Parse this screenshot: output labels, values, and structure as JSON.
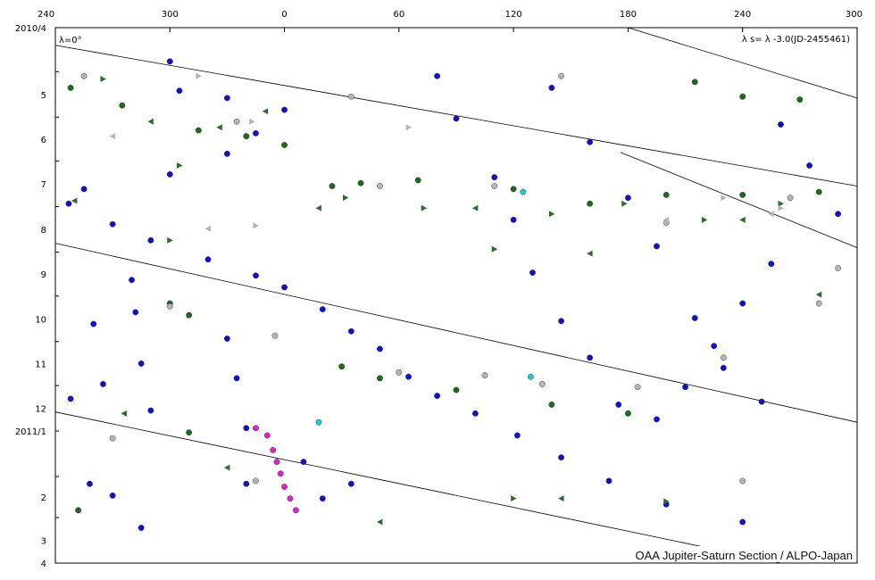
{
  "chart_data": {
    "type": "scatter",
    "title": "",
    "xlabel": "",
    "ylabel": "",
    "x_ticks": [
      "240",
      "300",
      "0",
      "60",
      "120",
      "180",
      "240",
      "300"
    ],
    "x_tick_longitudes": [
      240,
      300,
      360,
      420,
      480,
      540,
      600,
      660
    ],
    "xlim": [
      240,
      660
    ],
    "y_ticks": [
      "2010/4",
      "5",
      "6",
      "7",
      "8",
      "9",
      "10",
      "11",
      "12",
      "2011/1",
      "2",
      "3",
      "4"
    ],
    "ylim": [
      "2010-04-01",
      "2011-04-01"
    ],
    "grid": false,
    "annotations": {
      "lambda_label": "λ=0°",
      "system_label": "λ s= λ -3.0(JD-2455461)",
      "credit": "OAA Jupiter-Saturn Section / ALPO-Japan"
    },
    "reference_lines": [
      {
        "from": [
          240,
          "2010-04-13"
        ],
        "to": [
          660,
          "2010-07-18"
        ]
      },
      {
        "from": [
          240,
          "2010-08-26"
        ],
        "to": [
          660,
          "2010-12-26"
        ]
      },
      {
        "from": [
          240,
          "2010-12-19"
        ],
        "to": [
          620,
          "2011-04-01"
        ]
      },
      {
        "from": [
          540,
          "2010-04-01"
        ],
        "to": [
          660,
          "2010-05-19"
        ]
      },
      {
        "from": [
          536,
          "2010-06-25"
        ],
        "to": [
          660,
          "2010-08-29"
        ]
      }
    ],
    "series": [
      {
        "marker": "circle",
        "color": "#1111cc",
        "points": [
          [
            300,
            "2010-04-24"
          ],
          [
            305,
            "2010-05-14"
          ],
          [
            330,
            "2010-05-19"
          ],
          [
            360,
            "2010-05-27"
          ],
          [
            345,
            "2010-06-12"
          ],
          [
            330,
            "2010-06-26"
          ],
          [
            300,
            "2010-07-10"
          ],
          [
            255,
            "2010-07-20"
          ],
          [
            247,
            "2010-07-30"
          ],
          [
            270,
            "2010-08-13"
          ],
          [
            290,
            "2010-08-24"
          ],
          [
            320,
            "2010-09-06"
          ],
          [
            345,
            "2010-09-17"
          ],
          [
            360,
            "2010-09-25"
          ],
          [
            380,
            "2010-10-10"
          ],
          [
            395,
            "2010-10-25"
          ],
          [
            410,
            "2010-11-06"
          ],
          [
            425,
            "2010-11-25"
          ],
          [
            440,
            "2010-12-08"
          ],
          [
            460,
            "2010-12-20"
          ],
          [
            482,
            "2011-01-04"
          ],
          [
            505,
            "2011-01-19"
          ],
          [
            530,
            "2011-02-04"
          ],
          [
            560,
            "2011-02-20"
          ],
          [
            600,
            "2011-03-04"
          ],
          [
            620,
            "2010-06-06"
          ],
          [
            635,
            "2010-07-04"
          ],
          [
            650,
            "2010-08-06"
          ],
          [
            615,
            "2010-09-09"
          ],
          [
            600,
            "2010-10-06"
          ],
          [
            585,
            "2010-11-04"
          ],
          [
            570,
            "2010-12-02"
          ],
          [
            555,
            "2010-12-24"
          ],
          [
            500,
            "2010-05-12"
          ],
          [
            520,
            "2010-06-18"
          ],
          [
            540,
            "2010-07-26"
          ],
          [
            555,
            "2010-08-28"
          ],
          [
            575,
            "2010-10-16"
          ],
          [
            590,
            "2010-11-19"
          ],
          [
            610,
            "2010-12-12"
          ],
          [
            440,
            "2010-05-04"
          ],
          [
            450,
            "2010-06-02"
          ],
          [
            470,
            "2010-07-12"
          ],
          [
            480,
            "2010-08-10"
          ],
          [
            490,
            "2010-09-15"
          ],
          [
            505,
            "2010-10-18"
          ],
          [
            520,
            "2010-11-12"
          ],
          [
            535,
            "2010-12-14"
          ],
          [
            280,
            "2010-09-20"
          ],
          [
            282,
            "2010-10-12"
          ],
          [
            285,
            "2010-11-16"
          ],
          [
            290,
            "2010-12-18"
          ],
          [
            260,
            "2010-10-20"
          ],
          [
            265,
            "2010-11-30"
          ],
          [
            248,
            "2010-12-10"
          ],
          [
            330,
            "2010-10-30"
          ],
          [
            335,
            "2010-11-26"
          ],
          [
            340,
            "2010-12-30"
          ],
          [
            340,
            "2011-02-06"
          ],
          [
            370,
            "2011-01-22"
          ],
          [
            380,
            "2011-02-16"
          ],
          [
            395,
            "2011-02-06"
          ],
          [
            270,
            "2011-02-14"
          ],
          [
            258,
            "2011-02-06"
          ],
          [
            285,
            "2011-03-08"
          ]
        ]
      },
      {
        "marker": "circle",
        "color": "#1b6b1b",
        "points": [
          [
            248,
            "2010-05-12"
          ],
          [
            275,
            "2010-05-24"
          ],
          [
            315,
            "2010-06-10"
          ],
          [
            340,
            "2010-06-14"
          ],
          [
            360,
            "2010-06-20"
          ],
          [
            385,
            "2010-07-18"
          ],
          [
            400,
            "2010-07-16"
          ],
          [
            430,
            "2010-07-14"
          ],
          [
            480,
            "2010-07-20"
          ],
          [
            520,
            "2010-07-30"
          ],
          [
            560,
            "2010-07-24"
          ],
          [
            600,
            "2010-07-24"
          ],
          [
            640,
            "2010-07-22"
          ],
          [
            300,
            "2010-10-06"
          ],
          [
            310,
            "2010-10-14"
          ],
          [
            390,
            "2010-11-18"
          ],
          [
            410,
            "2010-11-26"
          ],
          [
            450,
            "2010-12-04"
          ],
          [
            500,
            "2010-12-14"
          ],
          [
            540,
            "2010-12-20"
          ],
          [
            575,
            "2010-05-08"
          ],
          [
            600,
            "2010-05-18"
          ],
          [
            630,
            "2010-05-20"
          ],
          [
            252,
            "2011-02-24"
          ],
          [
            310,
            "2011-01-02"
          ]
        ]
      },
      {
        "marker": "circle",
        "color": "#b4b4b4",
        "points": [
          [
            255,
            "2010-05-04"
          ],
          [
            335,
            "2010-06-04"
          ],
          [
            395,
            "2010-05-18"
          ],
          [
            410,
            "2010-07-18"
          ],
          [
            470,
            "2010-07-18"
          ],
          [
            505,
            "2010-05-04"
          ],
          [
            560,
            "2010-08-12"
          ],
          [
            625,
            "2010-07-26"
          ],
          [
            650,
            "2010-09-12"
          ],
          [
            300,
            "2010-10-08"
          ],
          [
            355,
            "2010-10-28"
          ],
          [
            420,
            "2010-11-22"
          ],
          [
            465,
            "2010-11-24"
          ],
          [
            495,
            "2010-11-30"
          ],
          [
            545,
            "2010-12-02"
          ],
          [
            590,
            "2010-11-12"
          ],
          [
            640,
            "2010-10-06"
          ],
          [
            270,
            "2011-01-06"
          ],
          [
            345,
            "2011-02-04"
          ],
          [
            600,
            "2011-02-04"
          ]
        ]
      },
      {
        "marker": "circle",
        "color": "#dd22cc",
        "points": [
          [
            345,
            "2010-12-30"
          ],
          [
            351,
            "2011-01-04"
          ],
          [
            354,
            "2011-01-14"
          ],
          [
            356,
            "2011-01-22"
          ],
          [
            358,
            "2011-01-30"
          ],
          [
            360,
            "2011-02-08"
          ],
          [
            363,
            "2011-02-16"
          ],
          [
            366,
            "2011-02-24"
          ]
        ]
      },
      {
        "marker": "circle",
        "color": "#22cccc",
        "points": [
          [
            378,
            "2010-12-26"
          ],
          [
            485,
            "2010-07-22"
          ],
          [
            489,
            "2010-11-25"
          ]
        ]
      },
      {
        "marker": "triangle-right",
        "color": "#2e6b2e",
        "points": [
          [
            265,
            "2010-05-06"
          ],
          [
            305,
            "2010-07-04"
          ],
          [
            392,
            "2010-07-26"
          ],
          [
            433,
            "2010-08-02"
          ],
          [
            470,
            "2010-08-30"
          ],
          [
            500,
            "2010-08-06"
          ],
          [
            538,
            "2010-07-30"
          ],
          [
            580,
            "2010-08-10"
          ],
          [
            620,
            "2010-07-30"
          ],
          [
            300,
            "2010-08-24"
          ],
          [
            560,
            "2011-02-18"
          ],
          [
            480,
            "2011-02-16"
          ]
        ]
      },
      {
        "marker": "triangle-left",
        "color": "#2e6b2e",
        "points": [
          [
            250,
            "2010-07-28"
          ],
          [
            290,
            "2010-06-04"
          ],
          [
            326,
            "2010-06-08"
          ],
          [
            350,
            "2010-05-28"
          ],
          [
            378,
            "2010-08-02"
          ],
          [
            460,
            "2010-08-02"
          ],
          [
            520,
            "2010-09-02"
          ],
          [
            600,
            "2010-08-10"
          ],
          [
            640,
            "2010-09-30"
          ],
          [
            276,
            "2010-12-20"
          ],
          [
            330,
            "2011-01-26"
          ],
          [
            410,
            "2011-03-04"
          ],
          [
            505,
            "2011-02-16"
          ]
        ]
      },
      {
        "marker": "triangle-right",
        "color": "#b4b4b4",
        "points": [
          [
            315,
            "2010-05-04"
          ],
          [
            343,
            "2010-06-04"
          ],
          [
            425,
            "2010-06-08"
          ],
          [
            590,
            "2010-07-26"
          ],
          [
            620,
            "2010-08-02"
          ],
          [
            345,
            "2010-08-14"
          ]
        ]
      },
      {
        "marker": "triangle-left",
        "color": "#b4b4b4",
        "points": [
          [
            270,
            "2010-06-14"
          ],
          [
            320,
            "2010-08-16"
          ],
          [
            615,
            "2010-08-06"
          ],
          [
            560,
            "2010-08-10"
          ]
        ]
      }
    ]
  }
}
